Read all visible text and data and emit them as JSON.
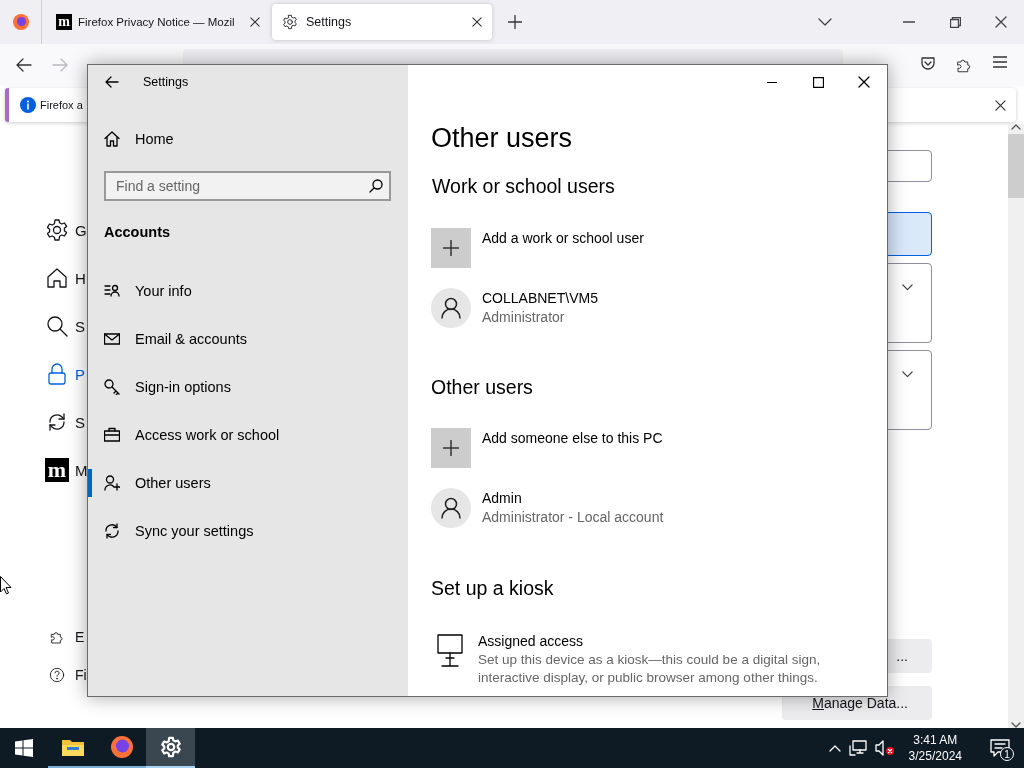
{
  "browser": {
    "tabs": [
      {
        "kind": "site",
        "logo": "m",
        "title": "Firefox Privacy Notice — Mozil",
        "selected": false
      },
      {
        "kind": "settings",
        "title": "Settings",
        "selected": true
      }
    ],
    "nav_buttons": [
      {
        "kind": "back",
        "disabled": false
      },
      {
        "kind": "forward",
        "disabled": true
      }
    ],
    "notification": {
      "text": "Firefox a"
    },
    "sidebar": [
      {
        "kind": "gear",
        "label": "G",
        "selected": false
      },
      {
        "kind": "home",
        "label": "H",
        "selected": false
      },
      {
        "kind": "search",
        "label": "S",
        "selected": false
      },
      {
        "kind": "lock",
        "label": "P",
        "selected": true
      },
      {
        "kind": "sync",
        "label": "S",
        "selected": false
      },
      {
        "kind": "logo",
        "logo": "m",
        "label": "M",
        "selected": false
      }
    ],
    "sidebar_footer": [
      {
        "kind": "extensions",
        "label": "E"
      },
      {
        "kind": "help",
        "label": "Fi"
      }
    ],
    "buttons": [
      {
        "label": "..."
      },
      {
        "label": "Manage Data...",
        "underline_first_letter": true
      }
    ]
  },
  "settings_window": {
    "title": "Settings",
    "home": "Home",
    "search": {
      "placeholder": "Find a setting"
    },
    "section": "Accounts",
    "nav": [
      {
        "kind": "info",
        "label": "Your info",
        "selected": false
      },
      {
        "kind": "mail",
        "label": "Email & accounts",
        "selected": false
      },
      {
        "kind": "key",
        "label": "Sign-in options",
        "selected": false
      },
      {
        "kind": "briefcase",
        "label": "Access work or school",
        "selected": false
      },
      {
        "kind": "people",
        "label": "Other users",
        "selected": true
      },
      {
        "kind": "sync",
        "label": "Sync your settings",
        "selected": false
      }
    ],
    "page_title": "Other users",
    "groups": [
      {
        "heading": "Work or school users",
        "items": [
          {
            "kind": "add",
            "label": "Add a work or school user"
          },
          {
            "kind": "user",
            "name": "COLLABNET\\VM5",
            "detail": "Administrator"
          }
        ]
      },
      {
        "heading": "Other users",
        "items": [
          {
            "kind": "add",
            "label": "Add someone else to this PC"
          },
          {
            "kind": "user",
            "name": "Admin",
            "detail": "Administrator - Local account"
          }
        ]
      },
      {
        "heading": "Set up a kiosk",
        "items": [
          {
            "kind": "kiosk",
            "name": "Assigned access",
            "detail": "Set up this device as a kiosk—this could be a digital sign, interactive display, or public browser among other things."
          }
        ]
      }
    ]
  },
  "taskbar": {
    "apps": [
      {
        "kind": "explorer",
        "running": true,
        "active": false
      },
      {
        "kind": "firefox",
        "running": true,
        "active": false
      },
      {
        "kind": "settings",
        "running": true,
        "active": true
      }
    ],
    "clock": {
      "time": "3:41 AM",
      "date": "3/25/2024"
    },
    "notification_count": "1"
  }
}
